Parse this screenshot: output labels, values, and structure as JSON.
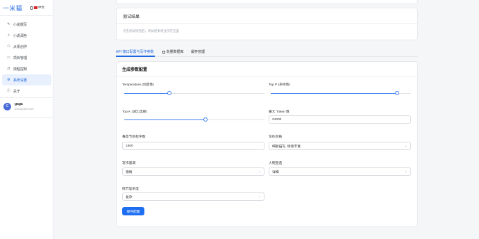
{
  "app": {
    "logo": "一米猫",
    "lang_label": "中文"
  },
  "sidebar": {
    "items": [
      {
        "label": "小说撰写",
        "icon": "pencil-icon"
      },
      {
        "label": "小说润色",
        "icon": "wand-icon"
      },
      {
        "label": "从零创作",
        "icon": "user-add-icon"
      },
      {
        "label": "项目管理",
        "icon": "folder-icon"
      },
      {
        "label": "流程控制",
        "icon": "flow-icon"
      },
      {
        "label": "系统设置",
        "icon": "gear-icon",
        "active": true
      },
      {
        "label": "关于",
        "icon": "info-icon"
      }
    ],
    "user": {
      "avatar": "G",
      "name": "gaga",
      "email": "1111@163.com"
    }
  },
  "test_results": {
    "title": "测试结果",
    "hint": "点击测试按钮后，测试结果将显示在这里"
  },
  "tabs": [
    {
      "label": "API 接口配置与写作参数",
      "active": true
    },
    {
      "label": "向量数据库"
    },
    {
      "label": "缓存管理"
    }
  ],
  "params": {
    "title": "生成参数配置",
    "temperature": {
      "label": "Temperature (创造性)",
      "value": 0.32
    },
    "top_p": {
      "label": "Top P (多样性)",
      "value": 0.9
    },
    "top_k": {
      "label": "Top K (词汇选择)",
      "value": 0.58
    },
    "max_tokens": {
      "label": "最大 Token 数",
      "value": "24000"
    },
    "chapter_words": {
      "label": "每章节目标字数",
      "value": "1500"
    },
    "writing_style": {
      "label": "写作风格",
      "value": "细腻描写, 情感丰富"
    },
    "writing_tone": {
      "label": "写作基调",
      "value": "激情"
    },
    "character_depth": {
      "label": "人物塑造",
      "value": "详细"
    },
    "plot_complexity": {
      "label": "情节复杂度",
      "value": "复杂"
    },
    "save_label": "保存配置"
  }
}
